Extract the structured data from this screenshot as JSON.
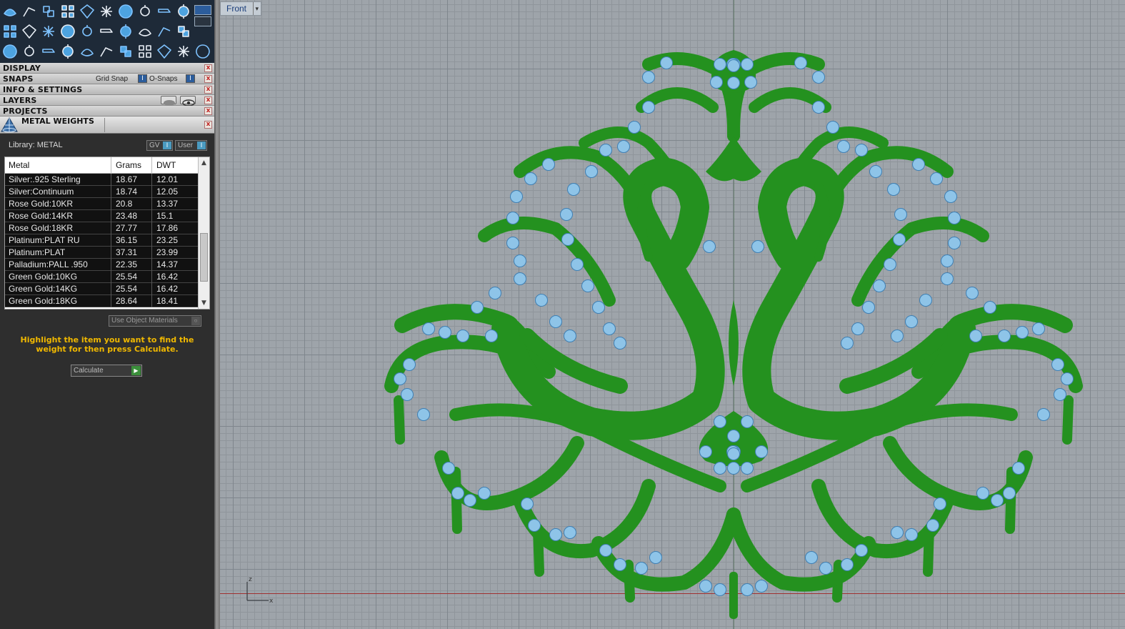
{
  "panels": {
    "display": "DISPLAY",
    "snaps": "SNAPS",
    "grid_snap": "Grid Snap",
    "o_snaps": "O-Snaps",
    "info_settings": "INFO & SETTINGS",
    "layers": "LAYERS",
    "projects": "PROJECTS",
    "metal_weights": "METAL WEIGHTS",
    "toggle_on": "I",
    "close": "x"
  },
  "library": {
    "label": "Library: METAL",
    "gv": "GV",
    "user": "User"
  },
  "table": {
    "headers": [
      "Metal",
      "Grams",
      "DWT"
    ],
    "rows": [
      {
        "metal": "Silver:.925 Sterling",
        "grams": "18.67",
        "dwt": "12.01"
      },
      {
        "metal": "Silver:Continuum",
        "grams": "18.74",
        "dwt": "12.05"
      },
      {
        "metal": "Rose Gold:10KR",
        "grams": "20.8",
        "dwt": "13.37"
      },
      {
        "metal": "Rose Gold:14KR",
        "grams": "23.48",
        "dwt": "15.1"
      },
      {
        "metal": "Rose Gold:18KR",
        "grams": "27.77",
        "dwt": "17.86"
      },
      {
        "metal": "Platinum:PLAT RU",
        "grams": "36.15",
        "dwt": "23.25"
      },
      {
        "metal": "Platinum:PLAT",
        "grams": "37.31",
        "dwt": "23.99"
      },
      {
        "metal": "Palladium:PALL .950",
        "grams": "22.35",
        "dwt": "14.37"
      },
      {
        "metal": "Green Gold:10KG",
        "grams": "25.54",
        "dwt": "16.42"
      },
      {
        "metal": "Green Gold:14KG",
        "grams": "25.54",
        "dwt": "16.42"
      },
      {
        "metal": "Green Gold:18KG",
        "grams": "28.64",
        "dwt": "18.41"
      }
    ]
  },
  "use_object_materials": "Use Object Materials",
  "hint": "Highlight the item you want to find the weight for then press Calculate.",
  "calculate": "Calculate",
  "viewport": {
    "name": "Front",
    "axis_z": "z",
    "axis_x": "x"
  },
  "colors": {
    "metal_green": "#24911f",
    "stone_blue": "#8ec4e8",
    "hint_yellow": "#f0b800",
    "viewport_bg": "#9ea4aa"
  }
}
